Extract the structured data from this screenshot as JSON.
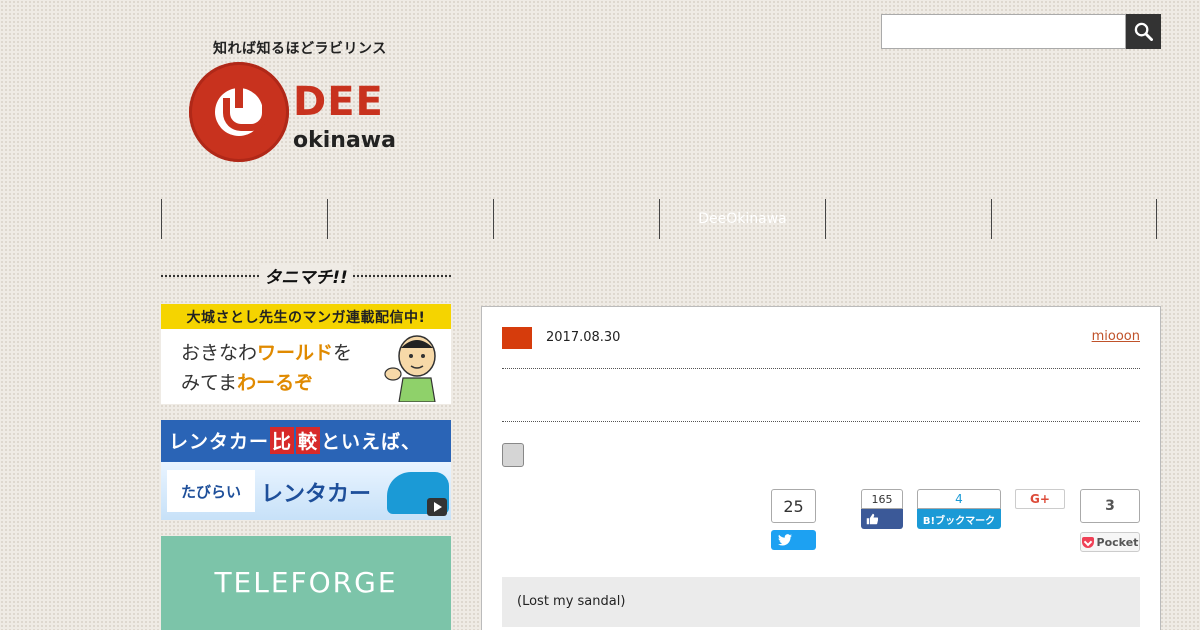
{
  "site": {
    "tagline": "知れば知るほどラビリンス",
    "logo_main": "DEE",
    "logo_sub": "okinawa"
  },
  "search": {
    "placeholder": "",
    "button_icon": "search-icon"
  },
  "nav": {
    "items": [
      "",
      "",
      "",
      "DeeOkinawa",
      "",
      ""
    ]
  },
  "sidebar": {
    "heading": "タニマチ!!",
    "banners": {
      "manga_top": "大城さとし先生のマンガ連載配信中!",
      "manga_line1_a": "おきなわ",
      "manga_line1_b": "ワールド",
      "manga_line1_c": "を",
      "manga_line2_a": "みてま",
      "manga_line2_b": "わーるぞ",
      "rental_pre": "レンタカー",
      "rental_hi1": "比",
      "rental_hi2": "較",
      "rental_post": "といえば、",
      "rental_brand": "たびらい",
      "rental_name": "レンタカー",
      "teleforge": "TELEFORGE"
    }
  },
  "article": {
    "date": "2017.08.30",
    "author": "miooon",
    "quote": "(Lost my sandal)",
    "colors": {
      "category": "#d63c0c",
      "author_link": "#c0522a"
    }
  },
  "share": {
    "twitter_count": "25",
    "facebook_count": "165",
    "hatena_count": "4",
    "hatena_label": "B!ブックマーク",
    "gplus_label": "G+",
    "pocket_count": "3",
    "pocket_label": "Pocket"
  }
}
